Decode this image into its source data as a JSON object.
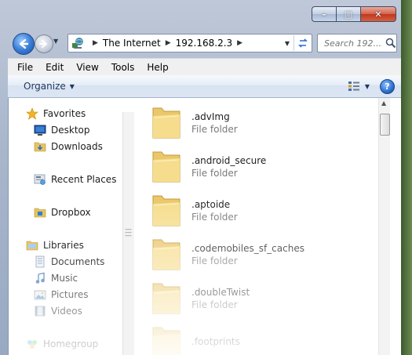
{
  "window": {
    "caption_buttons": {
      "minimize": "–",
      "maximize": "□",
      "close": "✕"
    }
  },
  "address": {
    "icon": "network-globe-icon",
    "segments": [
      "The Internet",
      "192.168.2.3"
    ],
    "separator": "▶"
  },
  "search": {
    "placeholder": "Search 192...."
  },
  "menu": {
    "items": [
      "File",
      "Edit",
      "View",
      "Tools",
      "Help"
    ]
  },
  "commandbar": {
    "organize_label": "Organize",
    "help_label": "?"
  },
  "navpane": {
    "favorites_label": "Favorites",
    "favorites": [
      "Desktop",
      "Downloads",
      "Recent Places",
      "Dropbox"
    ],
    "libraries_label": "Libraries",
    "libraries": [
      "Documents",
      "Music",
      "Pictures",
      "Videos"
    ],
    "homegroup_label": "Homegroup"
  },
  "files": [
    {
      "name": ".advImg",
      "type": "File folder"
    },
    {
      "name": ".android_secure",
      "type": "File folder"
    },
    {
      "name": ".aptoide",
      "type": "File folder"
    },
    {
      "name": ".codemobiles_sf_caches",
      "type": "File folder"
    },
    {
      "name": ".doubleTwist",
      "type": "File folder"
    },
    {
      "name": ".footprints",
      "type": ""
    }
  ],
  "colors": {
    "accent": "#2b6fd0",
    "folder": "#f2d57a"
  }
}
